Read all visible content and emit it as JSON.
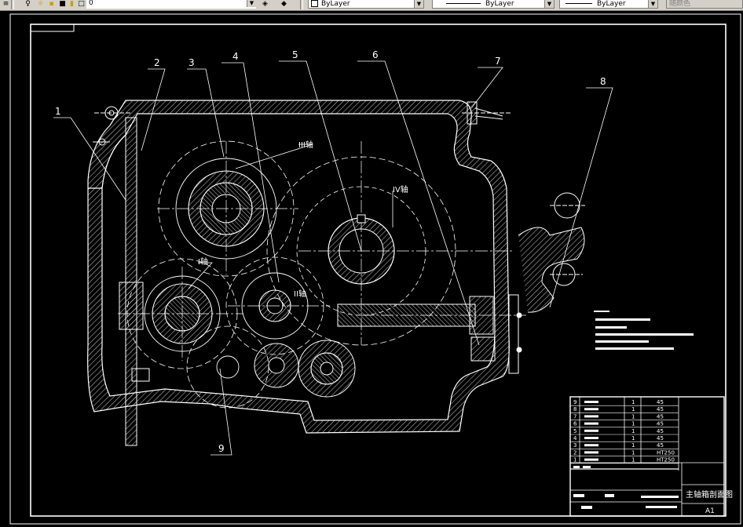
{
  "toolbar": {
    "layer_name": "0",
    "color_combo": "ByLayer",
    "linetype_combo": "ByLayer",
    "lineweight_combo": "ByLayer",
    "plotstyle_combo": "随颜色",
    "icons": [
      "layers-icon",
      "bulb-icon",
      "sun-icon",
      "lock-icon",
      "color-square-icon",
      "layer-prev-icon",
      "layer-states-icon"
    ]
  },
  "callouts": [
    "1",
    "2",
    "3",
    "4",
    "5",
    "6",
    "7",
    "8",
    "9"
  ],
  "shaft_labels": {
    "shaft3": "III轴",
    "shaft4": "IV轴",
    "shaft1": "I轴",
    "shaft2": "II轴"
  },
  "parts_table": {
    "rows": [
      {
        "no": "9",
        "qty": "1",
        "material": "45"
      },
      {
        "no": "8",
        "qty": "1",
        "material": "45"
      },
      {
        "no": "7",
        "qty": "1",
        "material": "45"
      },
      {
        "no": "6",
        "qty": "1",
        "material": "45"
      },
      {
        "no": "5",
        "qty": "1",
        "material": "45"
      },
      {
        "no": "4",
        "qty": "1",
        "material": "45"
      },
      {
        "no": "3",
        "qty": "1",
        "material": "45"
      },
      {
        "no": "2",
        "qty": "1",
        "material": "HT250"
      },
      {
        "no": "1",
        "qty": "1",
        "material": "HT250"
      }
    ]
  },
  "title_block": {
    "title": "主轴箱剖面图",
    "sheet_size": "A1"
  },
  "colors": {
    "background": "#000000",
    "lines": "#ffffff",
    "toolbar": "#d4d0c8"
  }
}
